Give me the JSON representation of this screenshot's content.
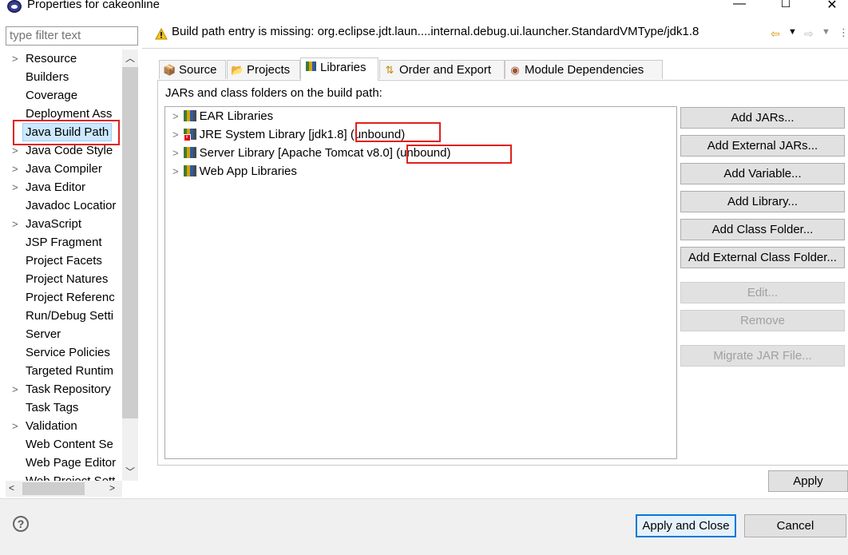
{
  "window": {
    "title": "Properties for cakeonline",
    "minimize_glyph": "—",
    "maximize_glyph": "☐",
    "close_glyph": "✕"
  },
  "filter": {
    "placeholder": "type filter text"
  },
  "tree": {
    "items": [
      {
        "label": "Resource",
        "expandable": true
      },
      {
        "label": "Builders",
        "expandable": false
      },
      {
        "label": "Coverage",
        "expandable": false
      },
      {
        "label": "Deployment Ass",
        "expandable": false
      },
      {
        "label": "Java Build Path",
        "expandable": false,
        "selected": true
      },
      {
        "label": "Java Code Style",
        "expandable": true
      },
      {
        "label": "Java Compiler",
        "expandable": true
      },
      {
        "label": "Java Editor",
        "expandable": true
      },
      {
        "label": "Javadoc Locatior",
        "expandable": false
      },
      {
        "label": "JavaScript",
        "expandable": true
      },
      {
        "label": "JSP Fragment",
        "expandable": false
      },
      {
        "label": "Project Facets",
        "expandable": false
      },
      {
        "label": "Project Natures",
        "expandable": false
      },
      {
        "label": "Project Referenc",
        "expandable": false
      },
      {
        "label": "Run/Debug Setti",
        "expandable": false
      },
      {
        "label": "Server",
        "expandable": false
      },
      {
        "label": "Service Policies",
        "expandable": false
      },
      {
        "label": "Targeted Runtim",
        "expandable": false
      },
      {
        "label": "Task Repository",
        "expandable": true
      },
      {
        "label": "Task Tags",
        "expandable": false
      },
      {
        "label": "Validation",
        "expandable": true
      },
      {
        "label": "Web Content Se",
        "expandable": false
      },
      {
        "label": "Web Page Editor",
        "expandable": false
      },
      {
        "label": "Web Project Sett",
        "expandable": false
      }
    ]
  },
  "status": {
    "message": "Build path entry is missing: org.eclipse.jdt.laun....internal.debug.ui.launcher.StandardVMType/jdk1.8",
    "icon": "warning-icon"
  },
  "tabs": [
    {
      "label": "Source",
      "icon": "source-icon",
      "active": false
    },
    {
      "label": "Projects",
      "icon": "projects-icon",
      "active": false
    },
    {
      "label": "Libraries",
      "icon": "libraries-icon",
      "active": true
    },
    {
      "label": "Order and Export",
      "icon": "order-export-icon",
      "active": false
    },
    {
      "label": "Module Dependencies",
      "icon": "module-icon",
      "active": false
    }
  ],
  "panel": {
    "label": "JARs and class folders on the build path:",
    "libraries": [
      {
        "label": "EAR Libraries",
        "icon": "library-icon"
      },
      {
        "label": "JRE System Library [jdk1.8] (unbound)",
        "icon": "library-error-icon"
      },
      {
        "label": "Server Library [Apache Tomcat v8.0] (unbound)",
        "icon": "library-icon"
      },
      {
        "label": "Web App Libraries",
        "icon": "library-icon"
      }
    ]
  },
  "buttons": {
    "add_jars": "Add JARs...",
    "add_external_jars": "Add External JARs...",
    "add_variable": "Add Variable...",
    "add_library": "Add Library...",
    "add_class_folder": "Add Class Folder...",
    "add_external_class_folder": "Add External Class Folder...",
    "edit": "Edit...",
    "remove": "Remove",
    "migrate_jar": "Migrate JAR File...",
    "apply": "Apply",
    "apply_and_close": "Apply and Close",
    "cancel": "Cancel"
  },
  "colors": {
    "selection": "#cce8ff",
    "annotation_red": "#e02020",
    "default_button_border": "#0078d7"
  }
}
